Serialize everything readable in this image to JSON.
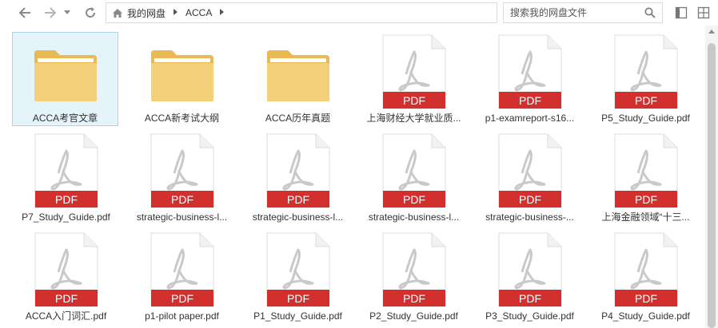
{
  "toolbar": {
    "back_icon": "arrow-left-icon",
    "forward_icon": "arrow-right-icon",
    "dropdown_icon": "chevron-down-icon",
    "refresh_icon": "refresh-icon"
  },
  "breadcrumb": {
    "home_icon": "home-icon",
    "items": [
      "我的网盘",
      "ACCA"
    ]
  },
  "search": {
    "placeholder": "搜索我的网盘文件",
    "value": ""
  },
  "colors": {
    "folder": "#f5d07a",
    "folder_dark": "#e8b955",
    "pdf_red": "#d22f2f",
    "selection": "#e5f3fb"
  },
  "files": [
    {
      "type": "folder",
      "name": "ACCA考官文章",
      "selected": true
    },
    {
      "type": "folder",
      "name": "ACCA新考试大纲"
    },
    {
      "type": "folder",
      "name": "ACCA历年真题"
    },
    {
      "type": "pdf",
      "name": "上海财经大学就业质..."
    },
    {
      "type": "pdf",
      "name": "p1-examreport-s16..."
    },
    {
      "type": "pdf",
      "name": "P5_Study_Guide.pdf"
    },
    {
      "type": "pdf",
      "name": "P7_Study_Guide.pdf"
    },
    {
      "type": "pdf",
      "name": "strategic-business-l..."
    },
    {
      "type": "pdf",
      "name": "strategic-business-l..."
    },
    {
      "type": "pdf",
      "name": "strategic-business-l..."
    },
    {
      "type": "pdf",
      "name": "strategic-business-..."
    },
    {
      "type": "pdf",
      "name": "上海金融领域“十三..."
    },
    {
      "type": "pdf",
      "name": "ACCA入门词汇.pdf"
    },
    {
      "type": "pdf",
      "name": "p1-pilot paper.pdf"
    },
    {
      "type": "pdf",
      "name": "P1_Study_Guide.pdf"
    },
    {
      "type": "pdf",
      "name": "P2_Study_Guide.pdf"
    },
    {
      "type": "pdf",
      "name": "P3_Study_Guide.pdf"
    },
    {
      "type": "pdf",
      "name": "P4_Study_Guide.pdf"
    }
  ],
  "pdf_badge": "PDF"
}
